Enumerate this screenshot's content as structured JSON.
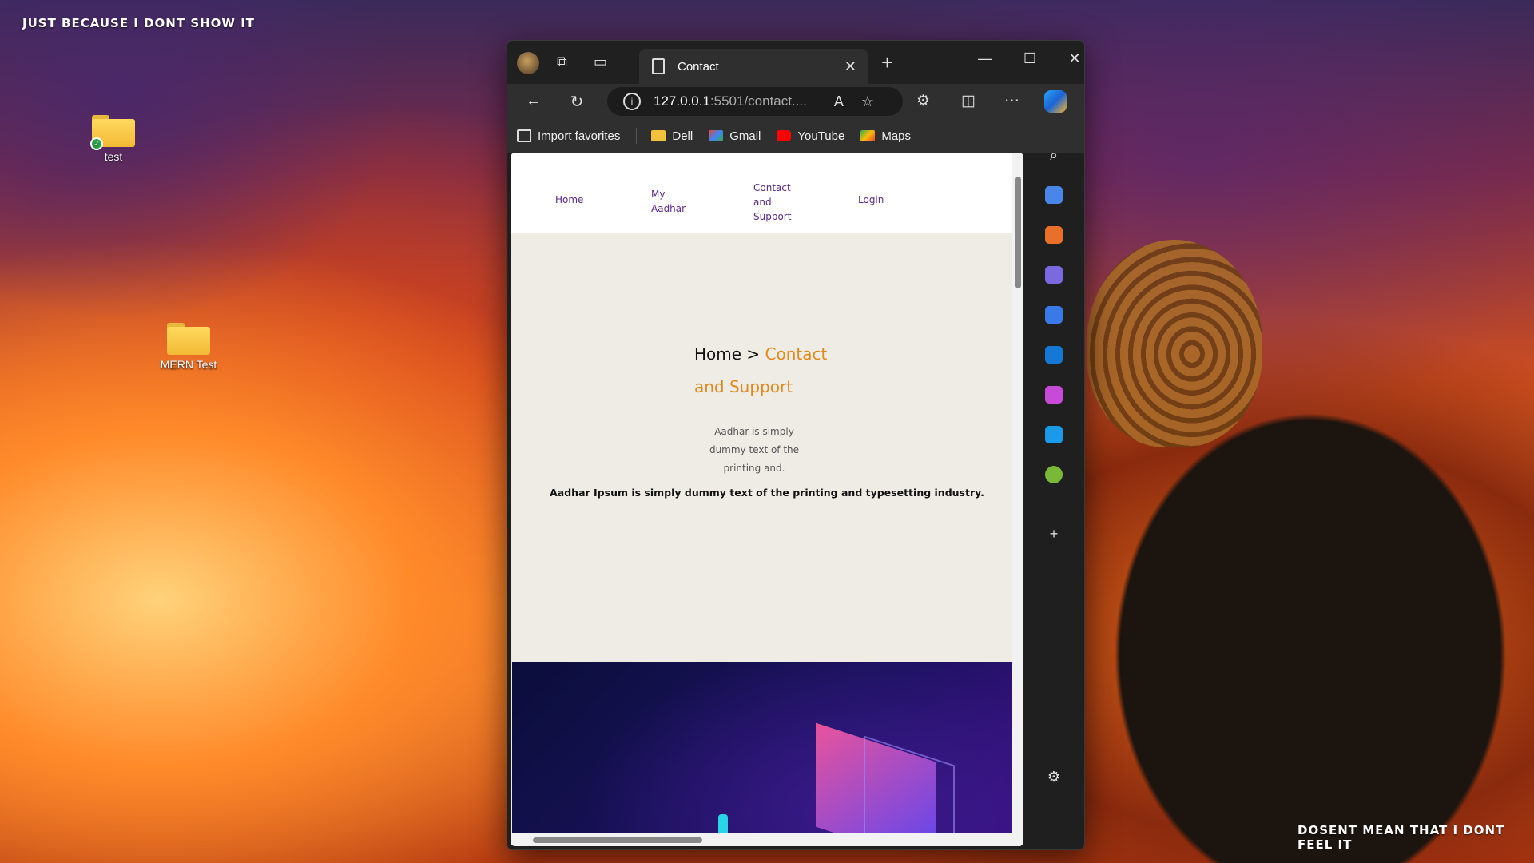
{
  "wallpaper": {
    "top_left_text": "JUST BECAUSE I DONT SHOW IT",
    "bottom_right_text": "DOSENT MEAN THAT I DONT FEEL IT"
  },
  "desktop_icons": [
    {
      "label": "test",
      "icon": "folder-icon",
      "synced": true
    },
    {
      "label": "MERN Test",
      "icon": "folder-icon",
      "synced": false
    }
  ],
  "browser": {
    "tab_title": "Contact",
    "url_host": "127.0.0.1",
    "url_rest": ":5501/contact....",
    "favorites": [
      {
        "label": "Import favorites",
        "icon": "import-icon"
      },
      {
        "label": "Dell",
        "icon": "folder-icon",
        "color": "#f2c23a"
      },
      {
        "label": "Gmail",
        "icon": "gmail-icon",
        "color": "#ea4335"
      },
      {
        "label": "YouTube",
        "icon": "youtube-icon",
        "color": "#ff0000"
      },
      {
        "label": "Maps",
        "icon": "maps-icon",
        "color": "#34a853"
      }
    ]
  },
  "site": {
    "nav": {
      "home": "Home",
      "my_aadhar_1": "My",
      "my_aadhar_2": "Aadhar",
      "contact_1": "Contact",
      "contact_2": "and",
      "contact_3": "Support",
      "login": "Login"
    },
    "breadcrumb": {
      "home": "Home",
      "sep": " > ",
      "current_1": "Contact",
      "current_2": "and Support"
    },
    "desc_lines": [
      "Aadhar is simply",
      "dummy text of the",
      "printing and."
    ],
    "lead": "Aadhar Ipsum is simply dummy text of the printing and typesetting industry.",
    "accent_color": "#e08a1e",
    "nav_color": "#5a2a8a"
  }
}
